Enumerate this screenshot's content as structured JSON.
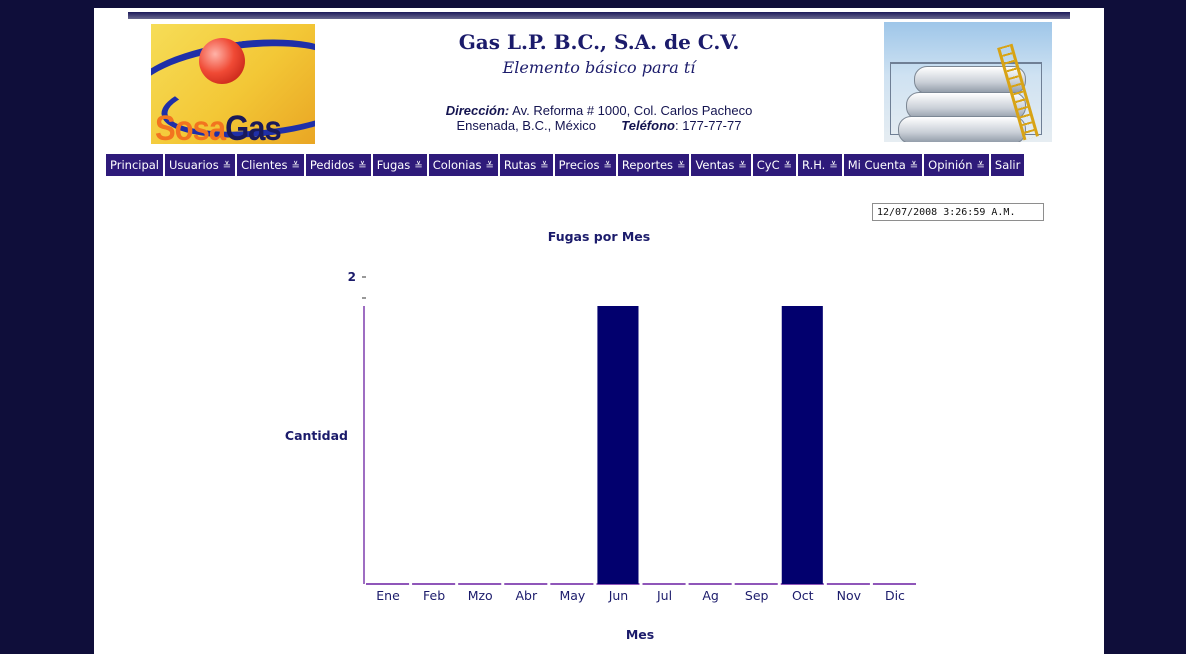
{
  "header": {
    "company": "Gas L.P. B.C., S.A. de C.V.",
    "slogan": "Elemento básico para tí",
    "address_label": "Dirección:",
    "address": "Av. Reforma # 1000, Col. Carlos Pacheco",
    "city": "Ensenada, B.C., México",
    "phone_label": "Teléfono",
    "phone": ": 177-77-77",
    "logo_text": [
      "Sosa",
      "Gas"
    ]
  },
  "nav": {
    "items": [
      {
        "label": "Principal",
        "has_menu": false
      },
      {
        "label": "Usuarios",
        "has_menu": true
      },
      {
        "label": "Clientes",
        "has_menu": true
      },
      {
        "label": "Pedidos",
        "has_menu": true
      },
      {
        "label": "Fugas",
        "has_menu": true
      },
      {
        "label": "Colonias",
        "has_menu": true
      },
      {
        "label": "Rutas",
        "has_menu": true
      },
      {
        "label": "Precios",
        "has_menu": true
      },
      {
        "label": "Reportes",
        "has_menu": true
      },
      {
        "label": "Ventas",
        "has_menu": true
      },
      {
        "label": "CyC",
        "has_menu": true
      },
      {
        "label": "R.H.",
        "has_menu": true
      },
      {
        "label": "Mi Cuenta",
        "has_menu": true
      },
      {
        "label": "Opinión",
        "has_menu": true
      },
      {
        "label": "Salir",
        "has_menu": false
      }
    ],
    "chevron": "≚"
  },
  "datetime": "12/07/2008   3:26:59 A.M.",
  "colors": {
    "nav_bg": "#2e1a7a",
    "bar": "#02006e",
    "axis": "#6a1fa2",
    "title": "#1b1b6b",
    "page_bg": "#0f0e3a"
  },
  "chart_data": {
    "type": "bar",
    "title": "Fugas por Mes",
    "xlabel": "Mes",
    "ylabel": "Cantidad",
    "categories": [
      "Ene",
      "Feb",
      "Mzo",
      "Abr",
      "May",
      "Jun",
      "Jul",
      "Ag",
      "Sep",
      "Oct",
      "Nov",
      "Dic"
    ],
    "values": [
      0,
      0,
      0,
      0,
      0,
      2,
      0,
      0,
      0,
      2,
      0,
      0
    ],
    "ylim": [
      0,
      2
    ],
    "y_tick_labels": [
      "2"
    ],
    "grid": false,
    "legend": "none"
  }
}
